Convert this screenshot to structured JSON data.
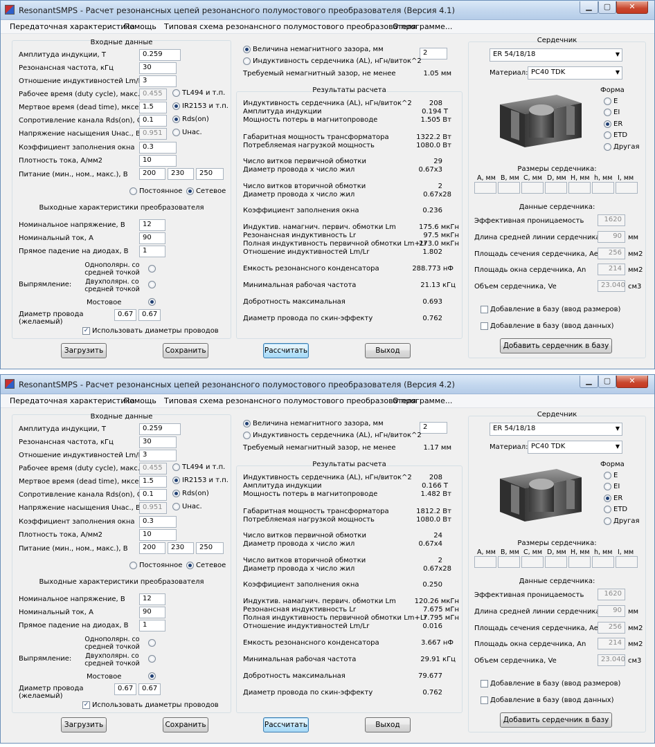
{
  "windows": [
    {
      "title": "ResonantSMPS - Расчет резонансных цепей резонансного полумостового преобразователя (Версия 4.1)",
      "menu": [
        "Передаточная характеристика",
        "Помощь",
        "Типовая схема резонансного полумостового преобразователя",
        "О программе..."
      ],
      "input": {
        "header": "Входные данные",
        "rows": [
          {
            "label": "Амплитуда индукции, Т",
            "value": "0.259"
          },
          {
            "label": "Резонансная частота, кГц",
            "value": "30"
          },
          {
            "label": "Отношение индуктивностей Lm/Lr",
            "value": "3"
          },
          {
            "label": "Рабочее время (duty cycle), макс.",
            "value": "0.455"
          },
          {
            "label": "Мертвое время (dead time), мксек",
            "value": "1.5"
          },
          {
            "label": "Сопротивление канала Rds(on), Ом",
            "value": "0.1"
          },
          {
            "label": "Напряжение насыщения Uнас., В",
            "value": "0.951"
          },
          {
            "label": "Коэффициент заполнения окна",
            "value": "0.3"
          },
          {
            "label": "Плотность тока, А/мм2",
            "value": "10"
          }
        ],
        "supply_label": "Питание (мин., ном., макс.), В",
        "supply": [
          "200",
          "230",
          "250"
        ],
        "ctrl_radios": [
          "TL494 и т.п.",
          "IR2153 и т.п.",
          "Rds(on)",
          "Uнас."
        ],
        "supply_type": [
          "Постоянное",
          "Сетевое"
        ]
      },
      "output": {
        "header": "Выходные характеристики преобразователя",
        "rows": [
          {
            "label": "Номинальное напряжение, В",
            "value": "12"
          },
          {
            "label": "Номинальный ток, А",
            "value": "90"
          },
          {
            "label": "Прямое падение на диодах, В",
            "value": "1"
          }
        ],
        "rect_label": "Выпрямление:",
        "rect_opts": [
          "Однополярн. со средней точкой",
          "Двухполярн. со средней точкой",
          "Мостовое"
        ],
        "wire_label": "Диаметр провода (желаемый)",
        "wire": [
          "0.67",
          "0.67"
        ],
        "use_wire": "Использовать диаметры проводов"
      },
      "gap": {
        "opt1": "Величина немагнитного зазора, мм",
        "opt2": "Индуктивность сердечника (AL), нГн/виток^2",
        "value": "2",
        "req_label": "Требуемый немагнитный зазор, не менее",
        "req_value": "1.05 мм"
      },
      "results_header": "Результаты расчета",
      "results": [
        {
          "label": "Индуктивность сердечника (AL), нГн/виток^2",
          "value": "208"
        },
        {
          "label": "Амплитуда индукции",
          "value": "0.194 Т"
        },
        {
          "label": "Мощность потерь в магнитопроводе",
          "value": "1.505 Вт"
        },
        {
          "label": "Габаритная мощность трансформатора",
          "value": "1322.2 Вт"
        },
        {
          "label": "Потребляемая нагрузкой мощность",
          "value": "1080.0 Вт"
        },
        {
          "label": "Число витков первичной обмотки",
          "value": "29"
        },
        {
          "label": "Диаметр провода х число жил",
          "value": "0.67х3"
        },
        {
          "label": "Число витков вторичной обмотки",
          "value": "2"
        },
        {
          "label": "Диаметр провода х число жил",
          "value": "0.67х28"
        },
        {
          "label": "Коэффициент заполнения окна",
          "value": "0.236"
        },
        {
          "label": "Индуктив. намагнич. первич. обмотки Lm",
          "value": "175.6 мкГн"
        },
        {
          "label": "Резонансная индуктивность Lr",
          "value": "97.5 мкГн"
        },
        {
          "label": "Полная индуктивность первичной обмотки  Lm+Lr",
          "value": "273.0 мкГн"
        },
        {
          "label": "Отношение индуктивностей Lm/Lr",
          "value": "1.802"
        },
        {
          "label": "Емкость резонансного конденсатора",
          "value": "288.773 нФ"
        },
        {
          "label": "Минимальная рабочая частота",
          "value": "21.13 кГц"
        },
        {
          "label": "Добротность максимальная",
          "value": "0.693"
        },
        {
          "label": "Диаметр провода по скин-эффекту",
          "value": "0.762"
        }
      ],
      "core": {
        "header": "Сердечник",
        "type": "ER 54/18/18",
        "material_label": "Материал:",
        "material": "PC40 TDK",
        "shape_label": "Форма",
        "shapes": [
          "E",
          "EI",
          "ER",
          "ETD",
          "Другая"
        ],
        "dims_label": "Размеры сердечника:",
        "dims": [
          "A, мм",
          "B, мм",
          "C, мм",
          "D, мм",
          "H, мм",
          "h, мм",
          "I, мм"
        ],
        "data_label": "Данные сердечника:",
        "data": [
          {
            "label": "Эффективная проницаемость",
            "value": "1620",
            "unit": ""
          },
          {
            "label": "Длина средней линии сердечника, le",
            "value": "90",
            "unit": "мм"
          },
          {
            "label": "Площадь сечения сердечника, Ae",
            "value": "256",
            "unit": "мм2"
          },
          {
            "label": "Площадь окна сердечника, An",
            "value": "214",
            "unit": "мм2"
          },
          {
            "label": "Объем сердечника, Ve",
            "value": "23.040",
            "unit": "см3"
          }
        ],
        "add_dims": "Добавление в базу (ввод размеров)",
        "add_data": "Добавление в базу (ввод данных)",
        "add_btn": "Добавить сердечник в базу"
      },
      "buttons": {
        "load": "Загрузить",
        "save": "Сохранить",
        "calc": "Рассчитать",
        "exit": "Выход"
      }
    },
    {
      "title": "ResonantSMPS - Расчет резонансных цепей резонансного полумостового преобразователя (Версия 4.2)",
      "menu": [
        "Передаточная характеристика",
        "Помощь",
        "Типовая схема резонансного полумостового преобразователя",
        "О программе..."
      ],
      "input": {
        "header": "Входные данные",
        "rows": [
          {
            "label": "Амплитуда индукции, Т",
            "value": "0.259"
          },
          {
            "label": "Резонансная частота, кГц",
            "value": "30"
          },
          {
            "label": "Отношение индуктивностей Lm/Lr",
            "value": "3"
          },
          {
            "label": "Рабочее время (duty cycle), макс.",
            "value": "0.455"
          },
          {
            "label": "Мертвое время (dead time), мксек",
            "value": "1.5"
          },
          {
            "label": "Сопротивление канала Rds(on), Ом",
            "value": "0.1"
          },
          {
            "label": "Напряжение насыщения Uнас., В",
            "value": "0.951"
          },
          {
            "label": "Коэффициент заполнения окна",
            "value": "0.3"
          },
          {
            "label": "Плотность тока, А/мм2",
            "value": "10"
          }
        ],
        "supply_label": "Питание (мин., ном., макс.), В",
        "supply": [
          "200",
          "230",
          "250"
        ],
        "ctrl_radios": [
          "TL494 и т.п.",
          "IR2153 и т.п.",
          "Rds(on)",
          "Uнас."
        ],
        "supply_type": [
          "Постоянное",
          "Сетевое"
        ]
      },
      "output": {
        "header": "Выходные характеристики преобразователя",
        "rows": [
          {
            "label": "Номинальное напряжение, В",
            "value": "12"
          },
          {
            "label": "Номинальный ток, А",
            "value": "90"
          },
          {
            "label": "Прямое падение на диодах, В",
            "value": "1"
          }
        ],
        "rect_label": "Выпрямление:",
        "rect_opts": [
          "Однополярн. со средней точкой",
          "Двухполярн. со средней точкой",
          "Мостовое"
        ],
        "wire_label": "Диаметр провода (желаемый)",
        "wire": [
          "0.67",
          "0.67"
        ],
        "use_wire": "Использовать диаметры проводов"
      },
      "gap": {
        "opt1": "Величина немагнитного зазора, мм",
        "opt2": "Индуктивность сердечника (AL), нГн/виток^2",
        "value": "2",
        "req_label": "Требуемый немагнитный зазор, не менее",
        "req_value": "1.17 мм"
      },
      "results_header": "Результаты расчета",
      "results": [
        {
          "label": "Индуктивность сердечника (AL), нГн/виток^2",
          "value": "208"
        },
        {
          "label": "Амплитуда индукции",
          "value": "0.166 Т"
        },
        {
          "label": "Мощность потерь в магнитопроводе",
          "value": "1.482 Вт"
        },
        {
          "label": "Габаритная мощность трансформатора",
          "value": "1812.2 Вт"
        },
        {
          "label": "Потребляемая нагрузкой мощность",
          "value": "1080.0 Вт"
        },
        {
          "label": "Число витков первичной обмотки",
          "value": "24"
        },
        {
          "label": "Диаметр провода х число жил",
          "value": "0.67х4"
        },
        {
          "label": "Число витков вторичной обмотки",
          "value": "2"
        },
        {
          "label": "Диаметр провода х число жил",
          "value": "0.67х28"
        },
        {
          "label": "Коэффициент заполнения окна",
          "value": "0.250"
        },
        {
          "label": "Индуктив. намагнич. первич. обмотки Lm",
          "value": "120.26 мкГн"
        },
        {
          "label": "Резонансная индуктивность Lr",
          "value": "7.675 мГн"
        },
        {
          "label": "Полная индуктивность первичной обмотки  Lm+Lr",
          "value": "7.795 мГн"
        },
        {
          "label": "Отношение индуктивностей Lm/Lr",
          "value": "0.016"
        },
        {
          "label": "Емкость резонансного конденсатора",
          "value": "3.667 нФ"
        },
        {
          "label": "Минимальная рабочая частота",
          "value": "29.91 кГц"
        },
        {
          "label": "Добротность максимальная",
          "value": "79.677"
        },
        {
          "label": "Диаметр провода по скин-эффекту",
          "value": "0.762"
        }
      ],
      "core": {
        "header": "Сердечник",
        "type": "ER 54/18/18",
        "material_label": "Материал:",
        "material": "PC40 TDK",
        "shape_label": "Форма",
        "shapes": [
          "E",
          "EI",
          "ER",
          "ETD",
          "Другая"
        ],
        "dims_label": "Размеры сердечника:",
        "dims": [
          "A, мм",
          "B, мм",
          "C, мм",
          "D, мм",
          "H, мм",
          "h, мм",
          "I, мм"
        ],
        "data_label": "Данные сердечника:",
        "data": [
          {
            "label": "Эффективная проницаемость",
            "value": "1620",
            "unit": ""
          },
          {
            "label": "Длина средней линии сердечника, le",
            "value": "90",
            "unit": "мм"
          },
          {
            "label": "Площадь сечения сердечника, Ae",
            "value": "256",
            "unit": "мм2"
          },
          {
            "label": "Площадь окна сердечника, An",
            "value": "214",
            "unit": "мм2"
          },
          {
            "label": "Объем сердечника, Ve",
            "value": "23.040",
            "unit": "см3"
          }
        ],
        "add_dims": "Добавление в базу (ввод размеров)",
        "add_data": "Добавление в базу (ввод данных)",
        "add_btn": "Добавить сердечник в базу"
      },
      "buttons": {
        "load": "Загрузить",
        "save": "Сохранить",
        "calc": "Рассчитать",
        "exit": "Выход"
      }
    }
  ]
}
